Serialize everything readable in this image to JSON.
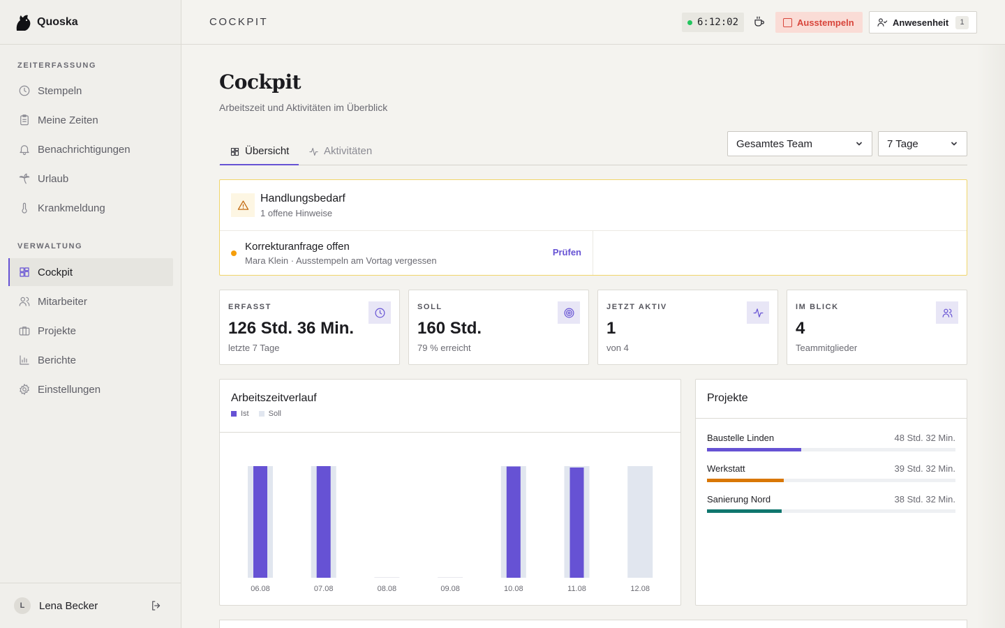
{
  "app": {
    "name": "Quoska"
  },
  "sidebar": {
    "sections": [
      {
        "title": "ZEITERFASSUNG",
        "items": [
          {
            "label": "Stempeln",
            "icon": "clock-icon"
          },
          {
            "label": "Meine Zeiten",
            "icon": "clipboard-icon"
          },
          {
            "label": "Benachrichtigungen",
            "icon": "bell-icon"
          },
          {
            "label": "Urlaub",
            "icon": "palm-tree-icon"
          },
          {
            "label": "Krankmeldung",
            "icon": "thermometer-icon"
          }
        ]
      },
      {
        "title": "VERWALTUNG",
        "items": [
          {
            "label": "Cockpit",
            "icon": "dashboard-icon",
            "active": true
          },
          {
            "label": "Mitarbeiter",
            "icon": "users-icon"
          },
          {
            "label": "Projekte",
            "icon": "briefcase-icon"
          },
          {
            "label": "Berichte",
            "icon": "bar-chart-icon"
          },
          {
            "label": "Einstellungen",
            "icon": "gear-icon"
          }
        ]
      }
    ],
    "user": {
      "initial": "L",
      "name": "Lena Becker"
    }
  },
  "topbar": {
    "breadcrumb": "COCKPIT",
    "timer": "6:12:02",
    "clock_out_label": "Ausstempeln",
    "presence_label": "Anwesenheit",
    "presence_count": "1"
  },
  "page": {
    "title": "Cockpit",
    "subtitle": "Arbeitszeit und Aktivitäten im Überblick",
    "tabs": [
      {
        "label": "Übersicht",
        "active": true
      },
      {
        "label": "Aktivitäten"
      }
    ],
    "team_filter": "Gesamtes Team",
    "range_filter": "7 Tage"
  },
  "alert": {
    "title": "Handlungsbedarf",
    "subtitle": "1 offene Hinweise",
    "items": [
      {
        "title": "Korrekturanfrage offen",
        "detail": "Mara Klein · Ausstempeln am Vortag vergessen",
        "action": "Prüfen"
      }
    ]
  },
  "kpis": [
    {
      "label": "ERFASST",
      "value": "126 Std. 36 Min.",
      "sub": "letzte 7 Tage",
      "icon": "clock-icon"
    },
    {
      "label": "SOLL",
      "value": "160 Std.",
      "sub": "79 % erreicht",
      "icon": "target-icon"
    },
    {
      "label": "JETZT AKTIV",
      "value": "1",
      "sub": "von 4",
      "icon": "activity-icon"
    },
    {
      "label": "IM BLICK",
      "value": "4",
      "sub": "Teammitglieder",
      "icon": "users-icon"
    }
  ],
  "worktime": {
    "title": "Arbeitszeitverlauf",
    "legend": [
      {
        "label": "Ist",
        "color": "#6652d4"
      },
      {
        "label": "Soll",
        "color": "#e1e6ef"
      }
    ]
  },
  "chart_data": {
    "type": "bar",
    "categories": [
      "06.08",
      "07.08",
      "08.08",
      "09.08",
      "10.08",
      "11.08",
      "12.08"
    ],
    "series": [
      {
        "name": "Ist",
        "values": [
          32.2,
          32.0,
          0,
          0,
          31.9,
          31.6,
          0
        ]
      },
      {
        "name": "Soll",
        "values": [
          32,
          32,
          0,
          0,
          32,
          32,
          32
        ]
      }
    ],
    "ylim": [
      0,
      32
    ],
    "grid": false,
    "legend": "top-left"
  },
  "projects": {
    "title": "Projekte",
    "items": [
      {
        "name": "Baustelle Linden",
        "hours": "48 Std. 32 Min.",
        "share": 0.38,
        "color": "#6652d4"
      },
      {
        "name": "Werkstatt",
        "hours": "39 Std. 32 Min.",
        "share": 0.31,
        "color": "#d97706"
      },
      {
        "name": "Sanierung Nord",
        "hours": "38 Std. 32 Min.",
        "share": 0.3,
        "color": "#0f766e"
      }
    ]
  }
}
